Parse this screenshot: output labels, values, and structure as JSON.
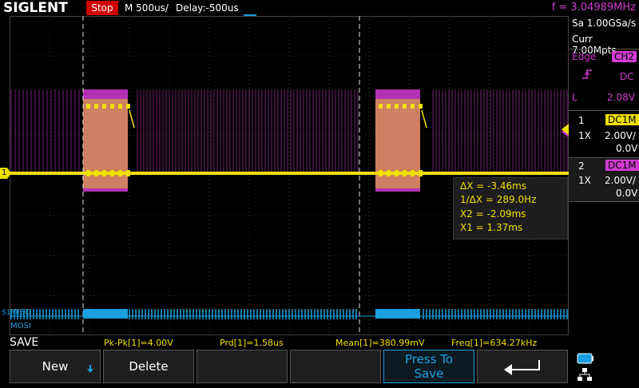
{
  "header": {
    "brand": "SIGLENT",
    "run_state": "Stop",
    "timebase": "M 500us/",
    "delay": "Delay:-500us",
    "frequency": "f = 3.04989MHz"
  },
  "acquisition": {
    "sample_rate": "Sa 1.00GSa/s",
    "memory": "Curr 7.00Mpts"
  },
  "trigger": {
    "type_label": "Edge",
    "source": "CH2",
    "coupling": "DC",
    "mode": "L",
    "level": "2.08V"
  },
  "channels": [
    {
      "number": "1",
      "coupling": "DC1M",
      "probe": "1X",
      "scale": "2.00V/",
      "offset": "0.0V",
      "color": "#f0e000"
    },
    {
      "number": "2",
      "coupling": "DC1M",
      "probe": "1X",
      "scale": "2.00V/",
      "offset": "0.0V",
      "color": "#d23bd2"
    }
  ],
  "cursors": {
    "delta_x": "ΔX = -3.46ms",
    "inv_delta_x": "1/ΔX = 289.0Hz",
    "x2": "X2 = -2.09ms",
    "x1": "X1 = 1.37ms"
  },
  "channel_marker": "1",
  "decode": {
    "line1": "MISO",
    "line2": "MOSI",
    "marker": "S1"
  },
  "measurements": {
    "pkpk": "Pk-Pk[1]=4.00V",
    "prd": "Prd[1]=1.58us",
    "mean": "Mean[1]=380.99mV",
    "freq": "Freq[1]=634.27kHz"
  },
  "menu": {
    "title": "SAVE",
    "new_label": "New",
    "delete_label": "Delete",
    "press_to_save_line1": "Press To",
    "press_to_save_line2": "Save"
  },
  "colors": {
    "ch1": "#f0e000",
    "ch2": "#d23bd2",
    "decode": "#1aa0e0",
    "stop": "#d00000"
  }
}
